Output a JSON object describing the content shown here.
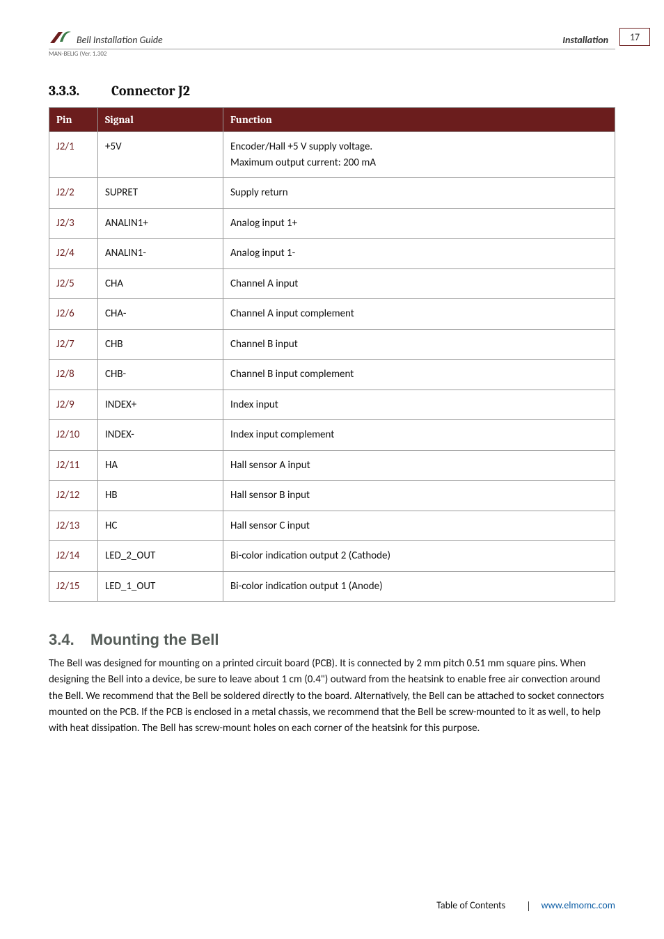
{
  "header": {
    "guide_title": "Bell Installation Guide",
    "section_label": "Installation",
    "version_line": "MAN-BELIG (Ver. 1.302",
    "page_number": "17"
  },
  "section_333": {
    "number": "3.3.3.",
    "title": "Connector J2",
    "columns": {
      "pin": "Pin",
      "signal": "Signal",
      "function": "Function"
    },
    "rows": [
      {
        "pin": "J2/1",
        "signal": "+5V",
        "function_line1": "Encoder/Hall +5 V supply voltage.",
        "function_line2": "Maximum output current: 200 mA"
      },
      {
        "pin": "J2/2",
        "signal": "SUPRET",
        "function_line1": "Supply return"
      },
      {
        "pin": "J2/3",
        "signal": "ANALIN1+",
        "function_line1": "Analog input 1+"
      },
      {
        "pin": "J2/4",
        "signal": "ANALIN1-",
        "function_line1": "Analog input 1-"
      },
      {
        "pin": "J2/5",
        "signal": "CHA",
        "function_line1": "Channel A input"
      },
      {
        "pin": "J2/6",
        "signal": "CHA-",
        "function_line1": "Channel A input complement"
      },
      {
        "pin": "J2/7",
        "signal": "CHB",
        "function_line1": "Channel B input"
      },
      {
        "pin": "J2/8",
        "signal": "CHB-",
        "function_line1": "Channel B input complement"
      },
      {
        "pin": "J2/9",
        "signal": "INDEX+",
        "function_line1": "Index input"
      },
      {
        "pin": "J2/10",
        "signal": "INDEX-",
        "function_line1": "Index input complement"
      },
      {
        "pin": "J2/11",
        "signal": "HA",
        "function_line1": "Hall sensor A input"
      },
      {
        "pin": "J2/12",
        "signal": "HB",
        "function_line1": "Hall sensor B input"
      },
      {
        "pin": "J2/13",
        "signal": "HC",
        "function_line1": "Hall sensor C input"
      },
      {
        "pin": "J2/14",
        "signal": "LED_2_OUT",
        "function_line1": "Bi-color indication output 2 (Cathode)"
      },
      {
        "pin": "J2/15",
        "signal": "LED_1_OUT",
        "function_line1": "Bi-color indication output 1 (Anode)"
      }
    ]
  },
  "section_34": {
    "number": "3.4.",
    "title": "Mounting the Bell",
    "paragraph": "The Bell was designed for mounting on a printed circuit board (PCB). It is connected by 2 mm pitch 0.51 mm square pins. When designing the Bell into a device, be sure to leave about 1 cm (0.4\") outward from the heatsink to enable free air convection around the Bell. We recommend that the Bell be soldered directly to the board. Alternatively, the Bell can be attached to socket connectors mounted on the PCB. If the PCB is enclosed in a metal chassis, we recommend that the Bell be screw-mounted to it as well, to help with heat dissipation. The Bell has screw-mount holes on each corner of the heatsink for this purpose."
  },
  "footer": {
    "toc": "Table of Contents",
    "link": "www.elmomc.com"
  }
}
